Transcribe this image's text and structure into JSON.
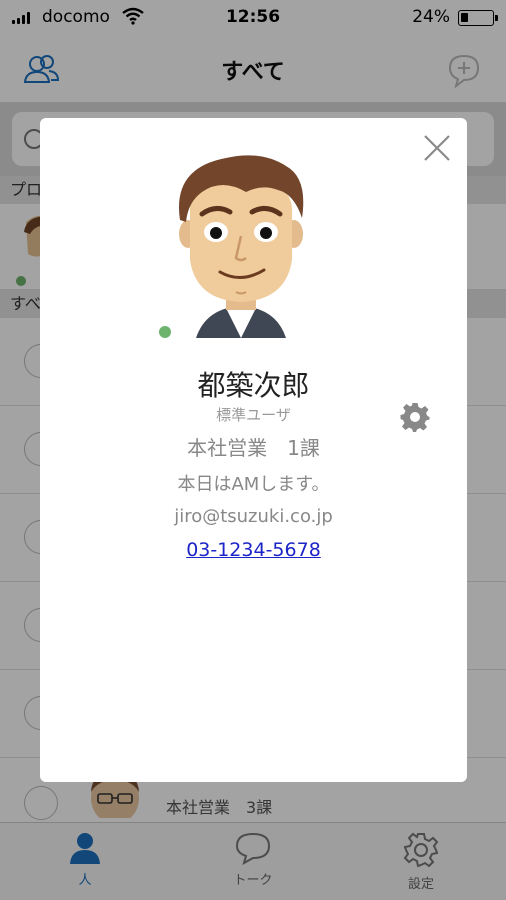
{
  "status_bar": {
    "carrier": "docomo",
    "time": "12:56",
    "battery": "24%"
  },
  "nav": {
    "title": "すべて",
    "left_icon": "people-icon",
    "right_icon": "add-chat-icon"
  },
  "sections": {
    "pro_header": "プロ",
    "all_header": "すべ"
  },
  "list": {
    "last_row_dept": "本社営業　3課"
  },
  "tabs": [
    {
      "label": "人",
      "icon": "person-icon"
    },
    {
      "label": "トーク",
      "icon": "chat-bubble-icon"
    },
    {
      "label": "設定",
      "icon": "gear-icon"
    }
  ],
  "profile": {
    "name": "都築次郎",
    "role": "標準ユーザ",
    "department": "本社営業　1課",
    "status_message": "本日はAMします。",
    "email": "jiro@tsuzuki.co.jp",
    "phone": "03-1234-5678"
  },
  "colors": {
    "accent": "#1d6fbe",
    "online": "#6db36d",
    "link": "#1c25c7"
  }
}
